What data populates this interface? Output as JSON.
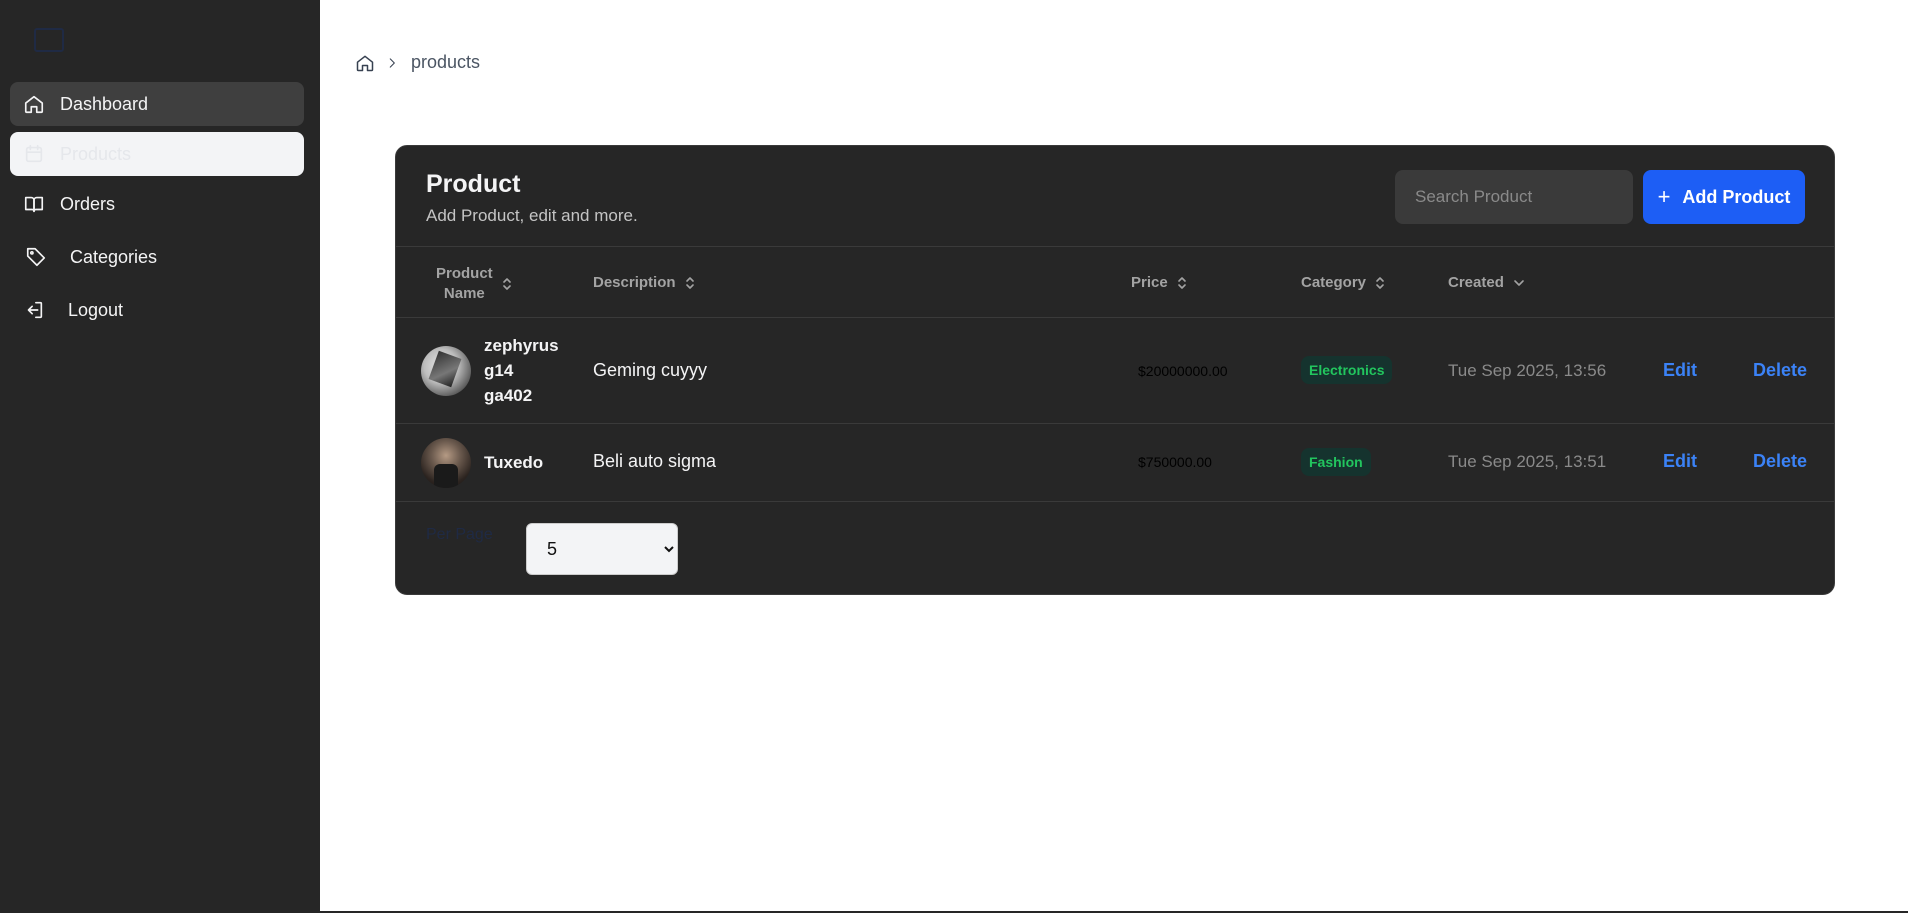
{
  "sidebar": {
    "items": [
      {
        "label": "Dashboard",
        "icon": "home-icon"
      },
      {
        "label": "Products",
        "icon": "calendar-icon"
      },
      {
        "label": "Orders",
        "icon": "book-icon"
      },
      {
        "label": "Categories",
        "icon": "tag-icon"
      },
      {
        "label": "Logout",
        "icon": "logout-icon"
      }
    ]
  },
  "breadcrumb": {
    "current": "products"
  },
  "card": {
    "title": "Product",
    "subtitle": "Add Product, edit and more.",
    "search_placeholder": "Search Product",
    "add_button_label": "Add Product"
  },
  "table": {
    "columns": {
      "name_line1": "Product",
      "name_line2": "Name",
      "description": "Description",
      "price": "Price",
      "category": "Category",
      "created": "Created"
    },
    "rows": [
      {
        "name_line1": "zephyrus",
        "name_line2": "g14",
        "name_line3": "ga402",
        "description": "Geming cuyyy",
        "price": "$20000000.00",
        "category": "Electronics",
        "created": "Tue Sep 2025, 13:56",
        "edit": "Edit",
        "delete": "Delete"
      },
      {
        "name": "Tuxedo",
        "description": "Beli auto sigma",
        "price": "$750000.00",
        "category": "Fashion",
        "created": "Tue Sep 2025, 13:51",
        "edit": "Edit",
        "delete": "Delete"
      }
    ]
  },
  "pagination": {
    "per_page_label": "Per Page",
    "per_page_value": "5"
  },
  "colors": {
    "sidebar_bg": "#262626",
    "card_bg": "#262626",
    "accent": "#1d5ef5",
    "link": "#3b82f6",
    "badge_text": "#22c55e"
  }
}
